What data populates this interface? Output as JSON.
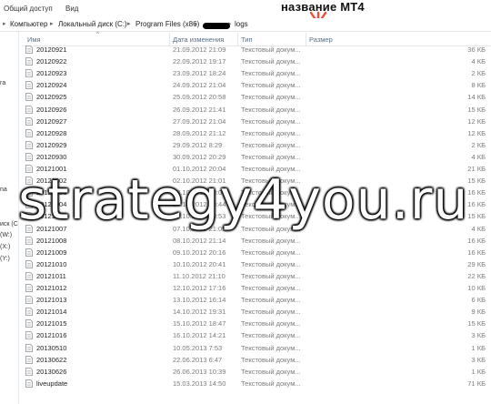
{
  "toolbar": {
    "items": [
      "Общий доступ",
      "Вид"
    ]
  },
  "annotation": {
    "title": "название МТ4"
  },
  "address": {
    "crumbs": [
      "Компьютер",
      "Локальный диск (C:)",
      "Program Files (x86)",
      "logs"
    ]
  },
  "sidebar": {
    "fragments": [
      "ra",
      "na",
      "иск (C",
      "(W:)",
      "(X:)",
      "(Y:)"
    ]
  },
  "columns": {
    "name": "Имя",
    "date": "Дата изменения",
    "type": "Тип",
    "size": "Размер"
  },
  "files": [
    {
      "name": "20120921",
      "date": "21.09.2012 21:09",
      "type": "Текстовый докум...",
      "size": "36 КБ"
    },
    {
      "name": "20120922",
      "date": "22.09.2012 19:17",
      "type": "Текстовый докум...",
      "size": "4 КБ"
    },
    {
      "name": "20120923",
      "date": "23.09.2012 18:24",
      "type": "Текстовый докум...",
      "size": "2 КБ"
    },
    {
      "name": "20120924",
      "date": "24.09.2012 21:04",
      "type": "Текстовый докум...",
      "size": "8 КБ"
    },
    {
      "name": "20120925",
      "date": "25.09.2012 20:58",
      "type": "Текстовый докум...",
      "size": "14 КБ"
    },
    {
      "name": "20120926",
      "date": "26.09.2012 21:41",
      "type": "Текстовый докум...",
      "size": "15 КБ"
    },
    {
      "name": "20120927",
      "date": "27.09.2012 21:04",
      "type": "Текстовый докум...",
      "size": "12 КБ"
    },
    {
      "name": "20120928",
      "date": "28.09.2012 21:12",
      "type": "Текстовый докум...",
      "size": "12 КБ"
    },
    {
      "name": "20120929",
      "date": "29.09.2012 8:29",
      "type": "Текстовый докум...",
      "size": "2 КБ"
    },
    {
      "name": "20120930",
      "date": "30.09.2012 20:29",
      "type": "Текстовый докум...",
      "size": "4 КБ"
    },
    {
      "name": "20121001",
      "date": "01.10.2012 20:04",
      "type": "Текстовый докум...",
      "size": "21 КБ"
    },
    {
      "name": "20121002",
      "date": "02.10.2012 21:01",
      "type": "Текстовый докум...",
      "size": "15 КБ"
    },
    {
      "name": "20121003",
      "date": "03.10.2012 20:07",
      "type": "Текстовый докум...",
      "size": "16 КБ"
    },
    {
      "name": "20121004",
      "date": "04.10.2012 20:44",
      "type": "Текстовый докум...",
      "size": "16 КБ"
    },
    {
      "name": "20121005",
      "date": "05.10.2012 20:53",
      "type": "Текстовый докум...",
      "size": "15 КБ"
    },
    {
      "name": "20121007",
      "date": "07.10.2012 21:05",
      "type": "Текстовый докум...",
      "size": "4 КБ"
    },
    {
      "name": "20121008",
      "date": "08.10.2012 21:14",
      "type": "Текстовый докум...",
      "size": "16 КБ"
    },
    {
      "name": "20121009",
      "date": "09.10.2012 20:16",
      "type": "Текстовый докум...",
      "size": "16 КБ"
    },
    {
      "name": "20121010",
      "date": "10.10.2012 20:41",
      "type": "Текстовый докум...",
      "size": "29 КБ"
    },
    {
      "name": "20121011",
      "date": "11.10.2012 21:10",
      "type": "Текстовый докум...",
      "size": "22 КБ"
    },
    {
      "name": "20121012",
      "date": "12.10.2012 17:16",
      "type": "Текстовый докум...",
      "size": "10 КБ"
    },
    {
      "name": "20121013",
      "date": "13.10.2012 16:14",
      "type": "Текстовый докум...",
      "size": "6 КБ"
    },
    {
      "name": "20121014",
      "date": "14.10.2012 19:31",
      "type": "Текстовый докум...",
      "size": "9 КБ"
    },
    {
      "name": "20121015",
      "date": "15.10.2012 18:47",
      "type": "Текстовый докум...",
      "size": "15 КБ"
    },
    {
      "name": "20121016",
      "date": "16.10.2012 14:21",
      "type": "Текстовый докум...",
      "size": "3 КБ"
    },
    {
      "name": "20130510",
      "date": "10.05.2013 7:53",
      "type": "Текстовый докум...",
      "size": "1 КБ"
    },
    {
      "name": "20130622",
      "date": "22.06.2013 6:47",
      "type": "Текстовый докум...",
      "size": "3 КБ"
    },
    {
      "name": "20130626",
      "date": "26.06.2013 10:39",
      "type": "Текстовый докум...",
      "size": "1 КБ"
    },
    {
      "name": "liveupdate",
      "date": "15.03.2013 14:50",
      "type": "Текстовый докум...",
      "size": "71 КБ"
    }
  ],
  "watermark": "strategy4you.ru",
  "colors": {
    "header_text": "#5a6f86",
    "secondary_text": "#7a7a7a",
    "annotation_arrow": "#f04a3a",
    "redaction": "#000000"
  },
  "icons": {
    "file": "text-file-icon",
    "separator": "chevron-right-icon",
    "arrow": "down-arrow-icon"
  }
}
